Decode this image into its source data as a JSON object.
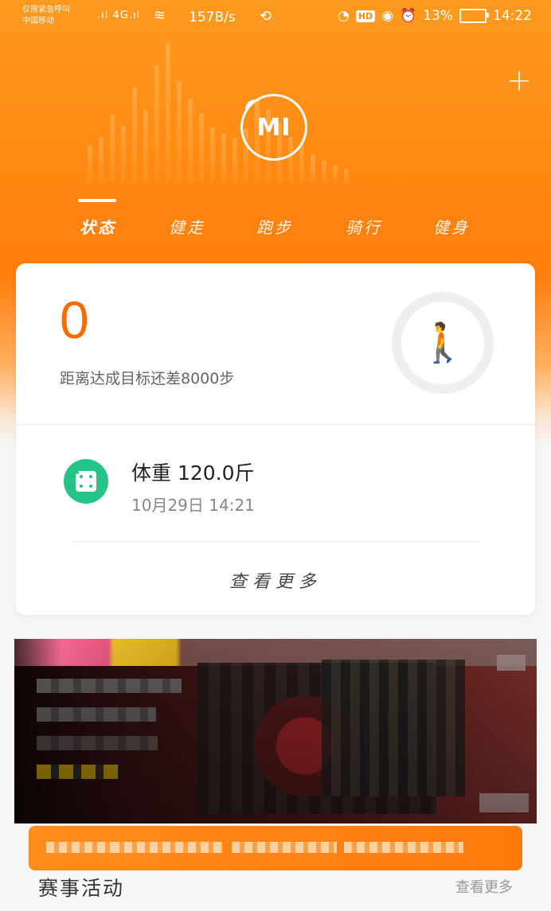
{
  "status_bar": {
    "carrier_top": "仅限紧急呼叫",
    "carrier_bottom": "中国移动",
    "signal": "4G",
    "speed": "157B/s",
    "battery": "13%",
    "time": "14:22"
  },
  "header": {
    "logo_text": "MI",
    "tabs": [
      "状态",
      "健走",
      "跑步",
      "骑行",
      "健身"
    ]
  },
  "summary": {
    "steps": "0",
    "goal_text": "距离达成目标还差8000步"
  },
  "weight": {
    "title": "体重 120.0斤",
    "time": "10月29日 14:21",
    "more": "查看更多"
  },
  "bottom": {
    "label": "赛事活动",
    "more": "查看更多"
  },
  "colors": {
    "accent": "#ff7a0b",
    "green": "#24c488"
  }
}
